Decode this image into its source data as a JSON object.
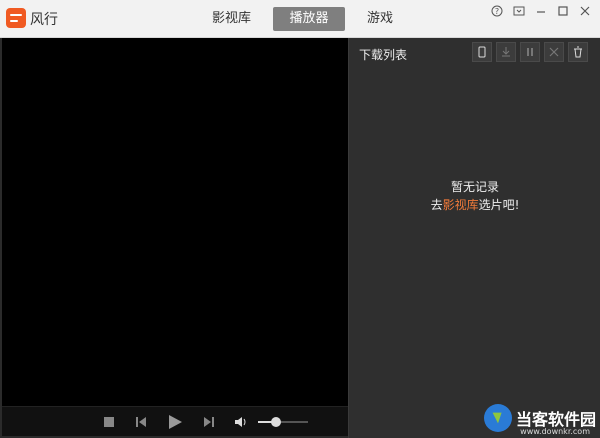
{
  "app": {
    "name": "风行"
  },
  "tabs": [
    {
      "label": "影视库",
      "active": false
    },
    {
      "label": "播放器",
      "active": true
    },
    {
      "label": "游戏",
      "active": false
    }
  ],
  "sidebar": {
    "title": "下载列表",
    "empty_line1": "暂无记录",
    "empty_prefix": "去",
    "empty_link": "影视库",
    "empty_suffix": "选片吧!"
  },
  "volume": {
    "level": 0.35
  },
  "watermark": {
    "text": "当客软件园",
    "url": "www.downkr.com"
  }
}
